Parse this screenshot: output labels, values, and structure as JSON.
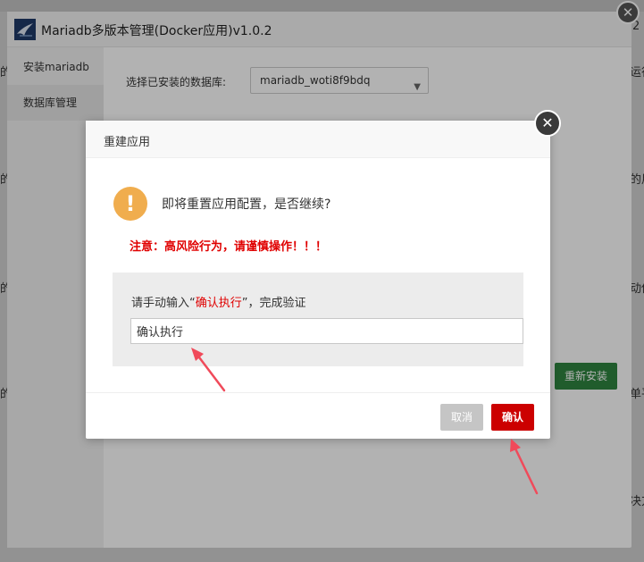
{
  "background": {
    "window_title": "Mariadb多版本管理(Docker应用)v1.0.2",
    "sidebar": [
      {
        "label": "安装mariadb"
      },
      {
        "label": "数据库管理"
      }
    ],
    "db_select_label": "选择已安装的数据库:",
    "db_select_value": "mariadb_woti8f9bdq",
    "rebuild_button": "重新安装",
    "edge_fragments": {
      "right": [
        "2",
        "运行",
        "的用",
        "动他",
        "单平",
        "决方"
      ],
      "left": [
        "的",
        "的",
        "的",
        "的"
      ]
    }
  },
  "dialog": {
    "title": "重建应用",
    "warning_icon_glyph": "!",
    "question": "即将重置应用配置，是否继续?",
    "danger_note": "注意：高风险行为，请谨慎操作！！！",
    "verify": {
      "prefix": "请手动输入“",
      "highlight": "确认执行",
      "suffix": "”，完成验证",
      "input_value": "确认执行"
    },
    "cancel_label": "取消",
    "confirm_label": "确认",
    "close_glyph": "✕"
  },
  "colors": {
    "danger": "#e00000",
    "warning": "#f0ad4e",
    "confirm_button": "#cc0000",
    "rebuild_button": "#2e8540",
    "annotation_arrow": "#f04a5a"
  }
}
